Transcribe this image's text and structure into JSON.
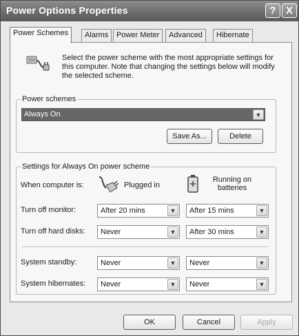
{
  "window": {
    "title": "Power Options Properties"
  },
  "titlebar_buttons": {
    "help": "?",
    "close": "X"
  },
  "tabs": [
    {
      "label": "Power Schemes",
      "active": true
    },
    {
      "label": "Alarms",
      "active": false
    },
    {
      "label": "Power Meter",
      "active": false
    },
    {
      "label": "Advanced",
      "active": false
    },
    {
      "label": "Hibernate",
      "active": false
    }
  ],
  "intro": {
    "icon": "power-scheme-icon",
    "text": "Select the power scheme with the most appropriate settings for this computer. Note that changing the settings below will modify the selected scheme."
  },
  "power_schemes": {
    "legend": "Power schemes",
    "selected": "Always On",
    "save_as_label": "Save As...",
    "delete_label": "Delete"
  },
  "settings": {
    "legend": "Settings for Always On power scheme",
    "when_label": "When computer is:",
    "plugged_in": "Plugged in",
    "on_batteries": "Running on batteries",
    "rows": [
      {
        "label": "Turn off monitor:",
        "plugged": "After 20 mins",
        "battery": "After 15 mins"
      },
      {
        "label": "Turn off hard disks:",
        "plugged": "Never",
        "battery": "After 30 mins"
      },
      {
        "label": "System standby:",
        "plugged": "Never",
        "battery": "Never"
      },
      {
        "label": "System hibernates:",
        "plugged": "Never",
        "battery": "Never"
      }
    ]
  },
  "footer": {
    "ok_label": "OK",
    "cancel_label": "Cancel",
    "apply_label": "Apply"
  }
}
